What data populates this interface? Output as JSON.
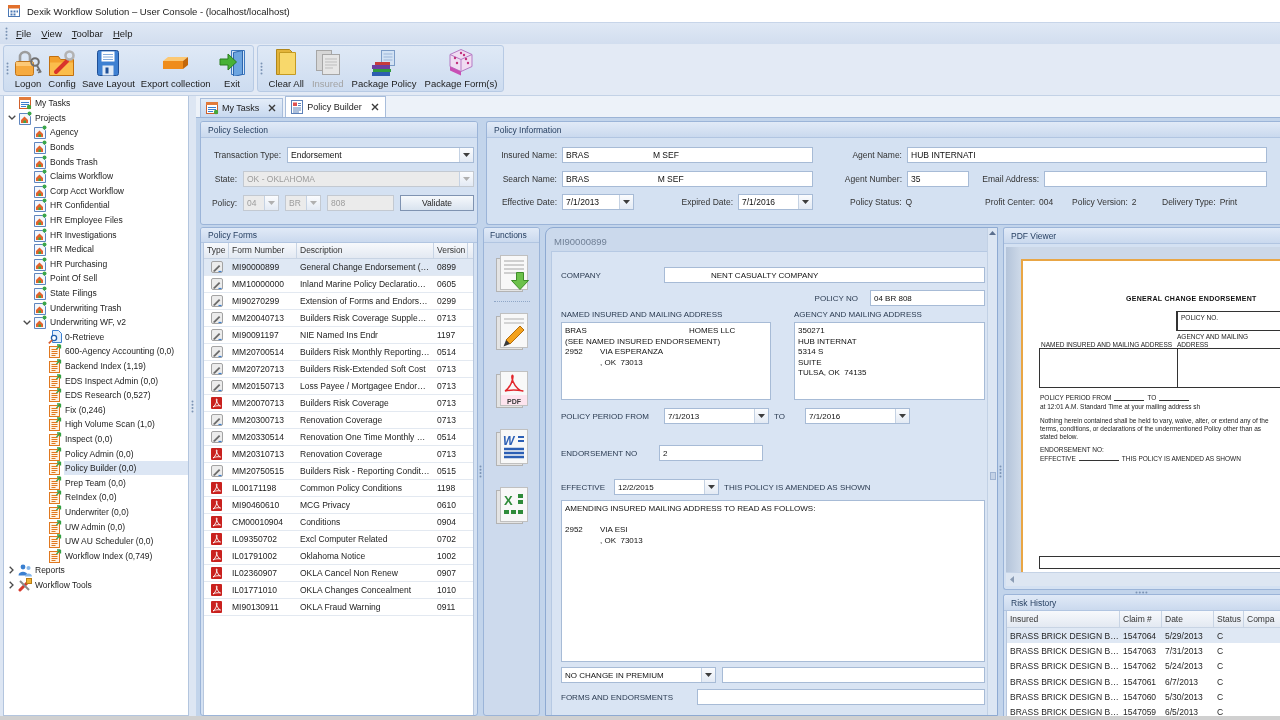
{
  "window": {
    "title": "Dexik Workflow Solution – User Console - (localhost/localhost)"
  },
  "menu": [
    "File",
    "View",
    "Toolbar",
    "Help"
  ],
  "toolbar": {
    "groups": [
      {
        "buttons": [
          {
            "label": "Logon",
            "disabled": false
          },
          {
            "label": "Config",
            "disabled": false
          },
          {
            "label": "Save Layout",
            "disabled": false
          },
          {
            "label": "Export collection",
            "disabled": false
          },
          {
            "label": "Exit",
            "disabled": false
          }
        ]
      },
      {
        "buttons": [
          {
            "label": "Clear All",
            "disabled": false
          },
          {
            "label": "Insured",
            "disabled": true
          },
          {
            "label": "Package Policy",
            "disabled": false
          },
          {
            "label": "Package Form(s)",
            "disabled": false
          }
        ]
      }
    ]
  },
  "tree": [
    {
      "label": "My Tasks",
      "kind": "tasks",
      "selected": false
    },
    {
      "label": "Projects",
      "kind": "projects",
      "selected": false,
      "expanded": true,
      "children": [
        {
          "label": "Agency",
          "kind": "project",
          "selected": false
        },
        {
          "label": "Bonds",
          "kind": "project",
          "selected": false
        },
        {
          "label": "Bonds Trash",
          "kind": "project",
          "selected": false
        },
        {
          "label": "Claims Workflow",
          "kind": "project",
          "selected": false
        },
        {
          "label": "Corp Acct Workflow",
          "kind": "project",
          "selected": false
        },
        {
          "label": "HR Confidential",
          "kind": "project",
          "selected": false
        },
        {
          "label": "HR Employee Files",
          "kind": "project",
          "selected": false
        },
        {
          "label": "HR Investigations",
          "kind": "project",
          "selected": false
        },
        {
          "label": "HR Medical",
          "kind": "project",
          "selected": false
        },
        {
          "label": "HR Purchasing",
          "kind": "project",
          "selected": false
        },
        {
          "label": "Point Of Sell",
          "kind": "project",
          "selected": false
        },
        {
          "label": "State Filings",
          "kind": "project",
          "selected": false
        },
        {
          "label": "Underwriting Trash",
          "kind": "project",
          "selected": false
        },
        {
          "label": "Underwriting WF, v2",
          "kind": "project",
          "selected": false,
          "expanded": true,
          "children": [
            {
              "label": "0-Retrieve",
              "kind": "search",
              "selected": false
            },
            {
              "label": "600-Agency Accounting (0,0)",
              "kind": "queue",
              "selected": false
            },
            {
              "label": "Backend Index (1,19)",
              "kind": "queue",
              "selected": false
            },
            {
              "label": "EDS Inspect Admin (0,0)",
              "kind": "queue",
              "selected": false
            },
            {
              "label": "EDS Research (0,527)",
              "kind": "queue",
              "selected": false
            },
            {
              "label": "Fix (0,246)",
              "kind": "queue",
              "selected": false
            },
            {
              "label": "High Volume Scan (1,0)",
              "kind": "queue",
              "selected": false
            },
            {
              "label": "Inspect (0,0)",
              "kind": "queue",
              "selected": false
            },
            {
              "label": "Policy Admin (0,0)",
              "kind": "queue",
              "selected": false
            },
            {
              "label": "Policy Builder (0,0)",
              "kind": "queue",
              "selected": true
            },
            {
              "label": "Prep Team (0,0)",
              "kind": "queue",
              "selected": false
            },
            {
              "label": "ReIndex (0,0)",
              "kind": "queue",
              "selected": false
            },
            {
              "label": "Underwriter (0,0)",
              "kind": "queue",
              "selected": false
            },
            {
              "label": "UW Admin (0,0)",
              "kind": "queue",
              "selected": false
            },
            {
              "label": "UW AU Scheduler (0,0)",
              "kind": "queue",
              "selected": false
            },
            {
              "label": "Workflow Index (0,749)",
              "kind": "queue",
              "selected": false
            }
          ]
        }
      ]
    },
    {
      "label": "Reports",
      "kind": "reports",
      "selected": false,
      "expanded": false
    },
    {
      "label": "Workflow Tools",
      "kind": "tools",
      "selected": false,
      "expanded": false
    }
  ],
  "tabs": [
    {
      "label": "My Tasks",
      "selected": false
    },
    {
      "label": "Policy Builder",
      "selected": true
    }
  ],
  "policy_selection": {
    "title": "Policy Selection",
    "rows": [
      {
        "label": "Transaction Type:",
        "controls": [
          {
            "kind": "combo",
            "value": "Endorsement",
            "disabled": false
          }
        ]
      },
      {
        "label": "State:",
        "controls": [
          {
            "kind": "combo",
            "value": "OK - OKLAHOMA",
            "disabled": true
          }
        ]
      },
      {
        "label": "Policy:",
        "controls": [
          {
            "kind": "combo",
            "value": "04",
            "disabled": true
          },
          {
            "kind": "combo",
            "value": "BR",
            "disabled": true
          },
          {
            "kind": "text",
            "value": "808",
            "disabled": true
          },
          {
            "kind": "button",
            "label": "Validate",
            "disabled": false
          }
        ]
      }
    ]
  },
  "policy_information": {
    "title": "Policy Information",
    "fields": [
      {
        "kind": "text",
        "label": "Insured Name:",
        "value": "BRAS                           M SEF"
      },
      {
        "kind": "text",
        "label": "Agent Name:",
        "value": "HUB INTERNATI"
      },
      {
        "kind": "text",
        "label": "Search Name:",
        "value": "BRAS                             M SEF"
      },
      {
        "kind": "text",
        "label": "Agent Number:",
        "value": "35"
      },
      {
        "kind": "text",
        "label": "Email Address:"
      },
      {
        "kind": "date",
        "label": "Effective Date:",
        "value": "7/1/2013"
      },
      {
        "kind": "date",
        "label": "Expired Date:",
        "value": "7/1/2016"
      },
      {
        "kind": "readout",
        "label": "Policy Status:",
        "value": "Q"
      },
      {
        "kind": "readout",
        "label": "Profit Center:",
        "value": "004"
      },
      {
        "kind": "readout",
        "label": "Policy Version:",
        "value": "2"
      },
      {
        "kind": "readout",
        "label": "Delivery Type:",
        "value": "Print"
      }
    ]
  },
  "policy_forms": {
    "title": "Policy Forms",
    "columns": [
      "Type",
      "Form Number",
      "Description",
      "Version"
    ],
    "rows": [
      {
        "kind": "document",
        "form_number": "MI90000899",
        "description": "General Change Endorsement (…",
        "version": "0899",
        "selected": true
      },
      {
        "kind": "document",
        "form_number": "MM10000000",
        "description": "Inland Marine Policy Declaratio…",
        "version": "0605",
        "selected": false
      },
      {
        "kind": "document",
        "form_number": "MI90270299",
        "description": "Extension of Forms and Endors…",
        "version": "0299",
        "selected": false
      },
      {
        "kind": "document",
        "form_number": "MM20040713",
        "description": "Builders Risk Coverage Supple…",
        "version": "0713",
        "selected": false
      },
      {
        "kind": "document",
        "form_number": "MI90091197",
        "description": "NIE Named Ins Endr",
        "version": "1197",
        "selected": false
      },
      {
        "kind": "document",
        "form_number": "MM20700514",
        "description": "Builders Risk Monthly Reporting…",
        "version": "0514",
        "selected": false
      },
      {
        "kind": "document",
        "form_number": "MM20720713",
        "description": "Builders Risk-Extended Soft Cost",
        "version": "0713",
        "selected": false
      },
      {
        "kind": "document",
        "form_number": "MM20150713",
        "description": "Loss Payee / Mortgagee Endor…",
        "version": "0713",
        "selected": false
      },
      {
        "kind": "pdf",
        "form_number": "MM20070713",
        "description": "Builders Risk Coverage",
        "version": "0713",
        "selected": false
      },
      {
        "kind": "document",
        "form_number": "MM20300713",
        "description": "Renovation Coverage",
        "version": "0713",
        "selected": false
      },
      {
        "kind": "document",
        "form_number": "MM20330514",
        "description": "Renovation One Time Monthly …",
        "version": "0514",
        "selected": false
      },
      {
        "kind": "pdf",
        "form_number": "MM20310713",
        "description": "Renovation Coverage",
        "version": "0713",
        "selected": false
      },
      {
        "kind": "document",
        "form_number": "MM20750515",
        "description": "Builders Risk - Reporting Condit…",
        "version": "0515",
        "selected": false
      },
      {
        "kind": "pdf",
        "form_number": "IL00171198",
        "description": "Common Policy Conditions",
        "version": "1198",
        "selected": false
      },
      {
        "kind": "pdf",
        "form_number": "MI90460610",
        "description": "MCG Privacy",
        "version": "0610",
        "selected": false
      },
      {
        "kind": "pdf",
        "form_number": "CM00010904",
        "description": "Conditions",
        "version": "0904",
        "selected": false
      },
      {
        "kind": "pdf",
        "form_number": "IL09350702",
        "description": "Excl Computer Related",
        "version": "0702",
        "selected": false
      },
      {
        "kind": "pdf",
        "form_number": "IL01791002",
        "description": "Oklahoma Notice",
        "version": "1002",
        "selected": false
      },
      {
        "kind": "pdf",
        "form_number": "IL02360907",
        "description": "OKLA Cancel Non Renew",
        "version": "0907",
        "selected": false
      },
      {
        "kind": "pdf",
        "form_number": "IL01771010",
        "description": "OKLA Changes Concealment",
        "version": "1010",
        "selected": false
      },
      {
        "kind": "pdf",
        "form_number": "MI90130911",
        "description": "OKLA Fraud Warning",
        "version": "0911",
        "selected": false
      }
    ]
  },
  "functions": {
    "title": "Functions",
    "items": [
      {
        "kind": "download"
      },
      {
        "kind": "edit"
      },
      {
        "kind": "pdf",
        "mark": "PDF"
      },
      {
        "kind": "word",
        "mark": "W"
      },
      {
        "kind": "excel",
        "mark": "X"
      }
    ]
  },
  "form": {
    "title": "MI90000899",
    "company": {
      "label": "COMPANY",
      "value": "NENT CASUALTY COMPANY"
    },
    "policy_no": {
      "label": "POLICY NO",
      "value": "04 BR 808"
    },
    "named_insured": {
      "label": "NAMED INSURED AND MAILING ADDRESS",
      "value": "BRAS                                              HOMES LLC\n(SEE NAMED INSURED ENDORSEMENT)\n2952\tVIA ESPERANZA\n\t, OK  73013"
    },
    "agency": {
      "label": "AGENCY AND MAILING ADDRESS",
      "value": "350271\nHUB INTERNAT\n5314 S\nSUITE\nTULSA, OK  74135"
    },
    "policy_period": {
      "label": "POLICY PERIOD FROM",
      "from": "7/1/2013",
      "to_label": "TO",
      "to": "7/1/2016"
    },
    "endorsement_no": {
      "label": "ENDORSEMENT NO",
      "value": "2"
    },
    "effective": {
      "label": "EFFECTIVE",
      "value": "12/2/2015",
      "note": "THIS POLICY IS AMENDED AS SHOWN"
    },
    "amendment": "AMENDING INSURED MAILING ADDRESS TO READ AS FOLLOWS:\n\n2952\tVIA ESI\n\t, OK  73013",
    "premium": {
      "value": "NO CHANGE IN PREMIUM"
    },
    "forms_and_endorsements": {
      "label": "FORMS AND ENDORSMENTS"
    }
  },
  "pdf_viewer": {
    "title": "PDF Viewer",
    "page": {
      "heading": "GENERAL CHANGE ENDORSEMENT",
      "policy_no_label": "POLICY NO.",
      "named_insured_label": "NAMED INSURED AND MAILING ADDRESS",
      "agency_label": "AGENCY AND MAILING ADDRESS",
      "period_label": "POLICY PERIOD FROM",
      "to_label": "TO",
      "period_note": "at 12:01 A.M. Standard Time at your mailing address sh",
      "notice": "Nothing herein contained shall be held to vary, waive, alter, or extend any of the terms, conditions, or declarations of the undermentioned Policy other than as stated below.",
      "endorsement_label": "ENDORSEMENT NO:",
      "effective_label": "EFFECTIVE",
      "amended_note": "THIS POLICY IS AMENDED AS SHOWN"
    }
  },
  "risk_history": {
    "title": "Risk History",
    "columns": [
      "Insured",
      "Claim #",
      "Date",
      "Status",
      "Compa"
    ],
    "rows": [
      {
        "cells": [
          "BRASS BRICK DESIGN B…",
          "1547064",
          "5/29/2013",
          "C"
        ],
        "selected": true
      },
      {
        "cells": [
          "BRASS BRICK DESIGN B…",
          "1547063",
          "7/31/2013",
          "C"
        ],
        "selected": false
      },
      {
        "cells": [
          "BRASS BRICK DESIGN B…",
          "1547062",
          "5/24/2013",
          "C"
        ],
        "selected": false
      },
      {
        "cells": [
          "BRASS BRICK DESIGN B…",
          "1547061",
          "6/7/2013",
          "C"
        ],
        "selected": false
      },
      {
        "cells": [
          "BRASS BRICK DESIGN B…",
          "1547060",
          "5/30/2013",
          "C"
        ],
        "selected": false
      },
      {
        "cells": [
          "BRASS BRICK DESIGN B…",
          "1547059",
          "6/5/2013",
          "C"
        ],
        "selected": false
      }
    ]
  }
}
